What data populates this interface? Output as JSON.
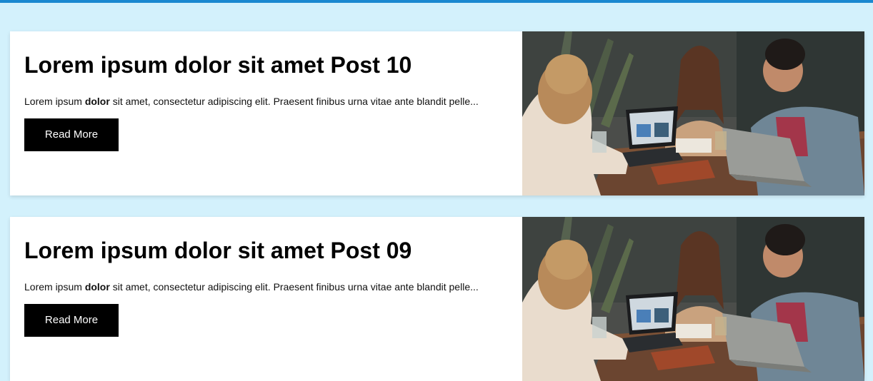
{
  "colors": {
    "page_background": "#d3f1fc",
    "top_bar": "#1a88d0",
    "button_background": "#000000",
    "button_text": "#ffffff"
  },
  "posts": [
    {
      "title": "Lorem ipsum dolor sit amet Post 10",
      "excerpt_before": "Lorem ipsum ",
      "excerpt_bold": "dolor",
      "excerpt_after": " sit amet, consectetur adipiscing elit. Praesent finibus urna vitae ante blandit pelle...",
      "button_label": "Read More",
      "image": "photo-three-people-laughing-at-table-with-laptops"
    },
    {
      "title": "Lorem ipsum dolor sit amet Post 09",
      "excerpt_before": "Lorem ipsum ",
      "excerpt_bold": "dolor",
      "excerpt_after": " sit amet, consectetur adipiscing elit. Praesent finibus urna vitae ante blandit pelle...",
      "button_label": "Read More",
      "image": "photo-three-people-laughing-at-table-with-laptops"
    }
  ]
}
